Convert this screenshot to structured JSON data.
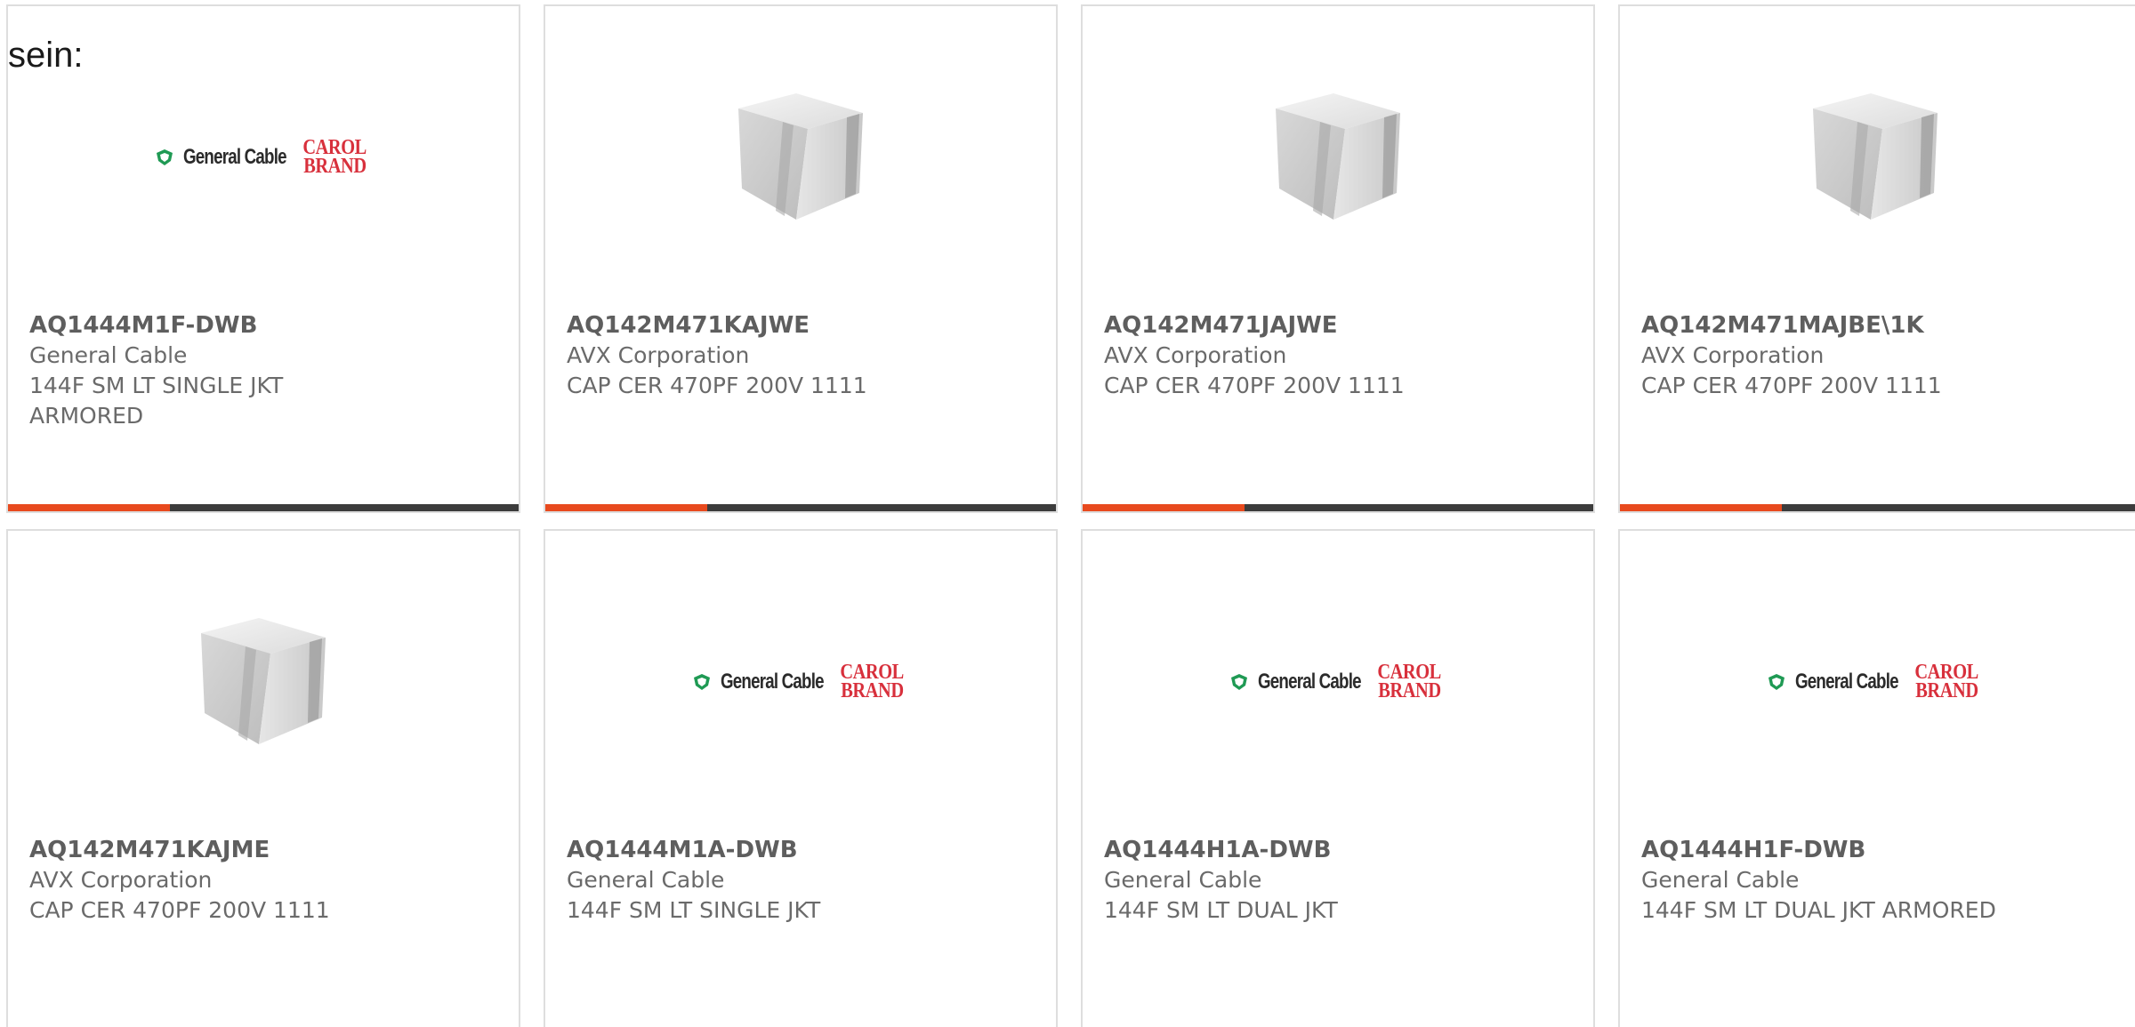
{
  "page": {
    "lead_text": "sein:"
  },
  "colors": {
    "accent": "#e84a1e",
    "bar_dark": "#3c3c3c",
    "card_border": "#dedede",
    "text_gray": "#6a6a6a",
    "brand_red": "#d8303c",
    "brand_green": "#1f9a54"
  },
  "products": [
    {
      "part_number": "AQ1444M1F-DWB",
      "manufacturer": "General Cable",
      "description": "144F SM LT SINGLE JKT ARMORED",
      "image": "general-cable-carol-brand-logo",
      "logo": {
        "gc": "General Cable",
        "carol": "CAROL",
        "brand": "BRAND"
      }
    },
    {
      "part_number": "AQ142M471KAJWE",
      "manufacturer": "AVX Corporation",
      "description": "CAP CER 470PF 200V 1111",
      "image": "ceramic-capacitor-cube"
    },
    {
      "part_number": "AQ142M471JAJWE",
      "manufacturer": "AVX Corporation",
      "description": "CAP CER 470PF 200V 1111",
      "image": "ceramic-capacitor-cube"
    },
    {
      "part_number": "AQ142M471MAJBE\\1K",
      "manufacturer": "AVX Corporation",
      "description": "CAP CER 470PF 200V 1111",
      "image": "ceramic-capacitor-cube"
    },
    {
      "part_number": "AQ142M471KAJME",
      "manufacturer": "AVX Corporation",
      "description": "CAP CER 470PF 200V 1111",
      "image": "ceramic-capacitor-cube"
    },
    {
      "part_number": "AQ1444M1A-DWB",
      "manufacturer": "General Cable",
      "description": "144F SM LT SINGLE JKT",
      "image": "general-cable-carol-brand-logo",
      "logo": {
        "gc": "General Cable",
        "carol": "CAROL",
        "brand": "BRAND"
      }
    },
    {
      "part_number": "AQ1444H1A-DWB",
      "manufacturer": "General Cable",
      "description": "144F SM LT DUAL JKT",
      "image": "general-cable-carol-brand-logo",
      "logo": {
        "gc": "General Cable",
        "carol": "CAROL",
        "brand": "BRAND"
      }
    },
    {
      "part_number": "AQ1444H1F-DWB",
      "manufacturer": "General Cable",
      "description": "144F SM LT DUAL JKT ARMORED",
      "image": "general-cable-carol-brand-logo",
      "logo": {
        "gc": "General Cable",
        "carol": "CAROL",
        "brand": "BRAND"
      }
    }
  ]
}
